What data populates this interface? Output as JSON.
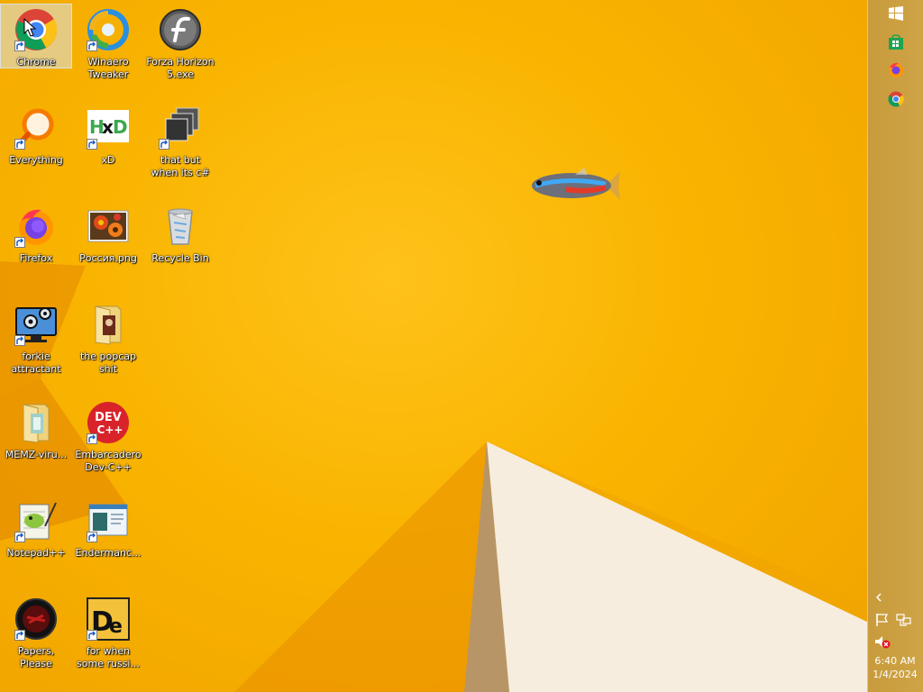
{
  "desktop": {
    "icons": [
      {
        "label": "Chrome",
        "icon": "chrome-icon"
      },
      {
        "label": "Winaero Tweaker",
        "icon": "winaero-icon"
      },
      {
        "label": "Forza Horizon 5.exe",
        "icon": "flash-icon"
      },
      {
        "label": "Everything",
        "icon": "search-icon"
      },
      {
        "label": "xD",
        "icon": "hxd-icon"
      },
      {
        "label": "that but when its c#",
        "icon": "stack-icon"
      },
      {
        "label": "Firefox",
        "icon": "firefox-icon"
      },
      {
        "label": "Россия.png",
        "icon": "image-icon"
      },
      {
        "label": "Recycle Bin",
        "icon": "recycle-bin-icon"
      },
      {
        "label": "forkie attractant",
        "icon": "monitor-gear-icon"
      },
      {
        "label": "the popcap shit",
        "icon": "folder-icon"
      },
      {
        "label": "MEMZ-viru...",
        "icon": "folder-icon"
      },
      {
        "label": "Embarcadero Dev-C++",
        "icon": "devcpp-icon"
      },
      {
        "label": "Notepad++",
        "icon": "notepadpp-icon"
      },
      {
        "label": "Endermanc...",
        "icon": "window-icon"
      },
      {
        "label": "Papers, Please",
        "icon": "papers-please-icon"
      },
      {
        "label": "for when some russi...",
        "icon": "de-icon"
      }
    ]
  },
  "taskbar": {
    "items": [
      "start-windows-icon",
      "store-icon",
      "firefox-icon",
      "chrome-icon"
    ],
    "tray": [
      "show-hidden-chevron-icon",
      "flag-icon",
      "network-icon",
      "volume-muted-icon"
    ]
  },
  "clock": {
    "time": "6:40 AM",
    "date": "1/4/2024"
  },
  "colors": {
    "wallpaper": "#f9b400",
    "taskbar": "#c89b3c"
  }
}
